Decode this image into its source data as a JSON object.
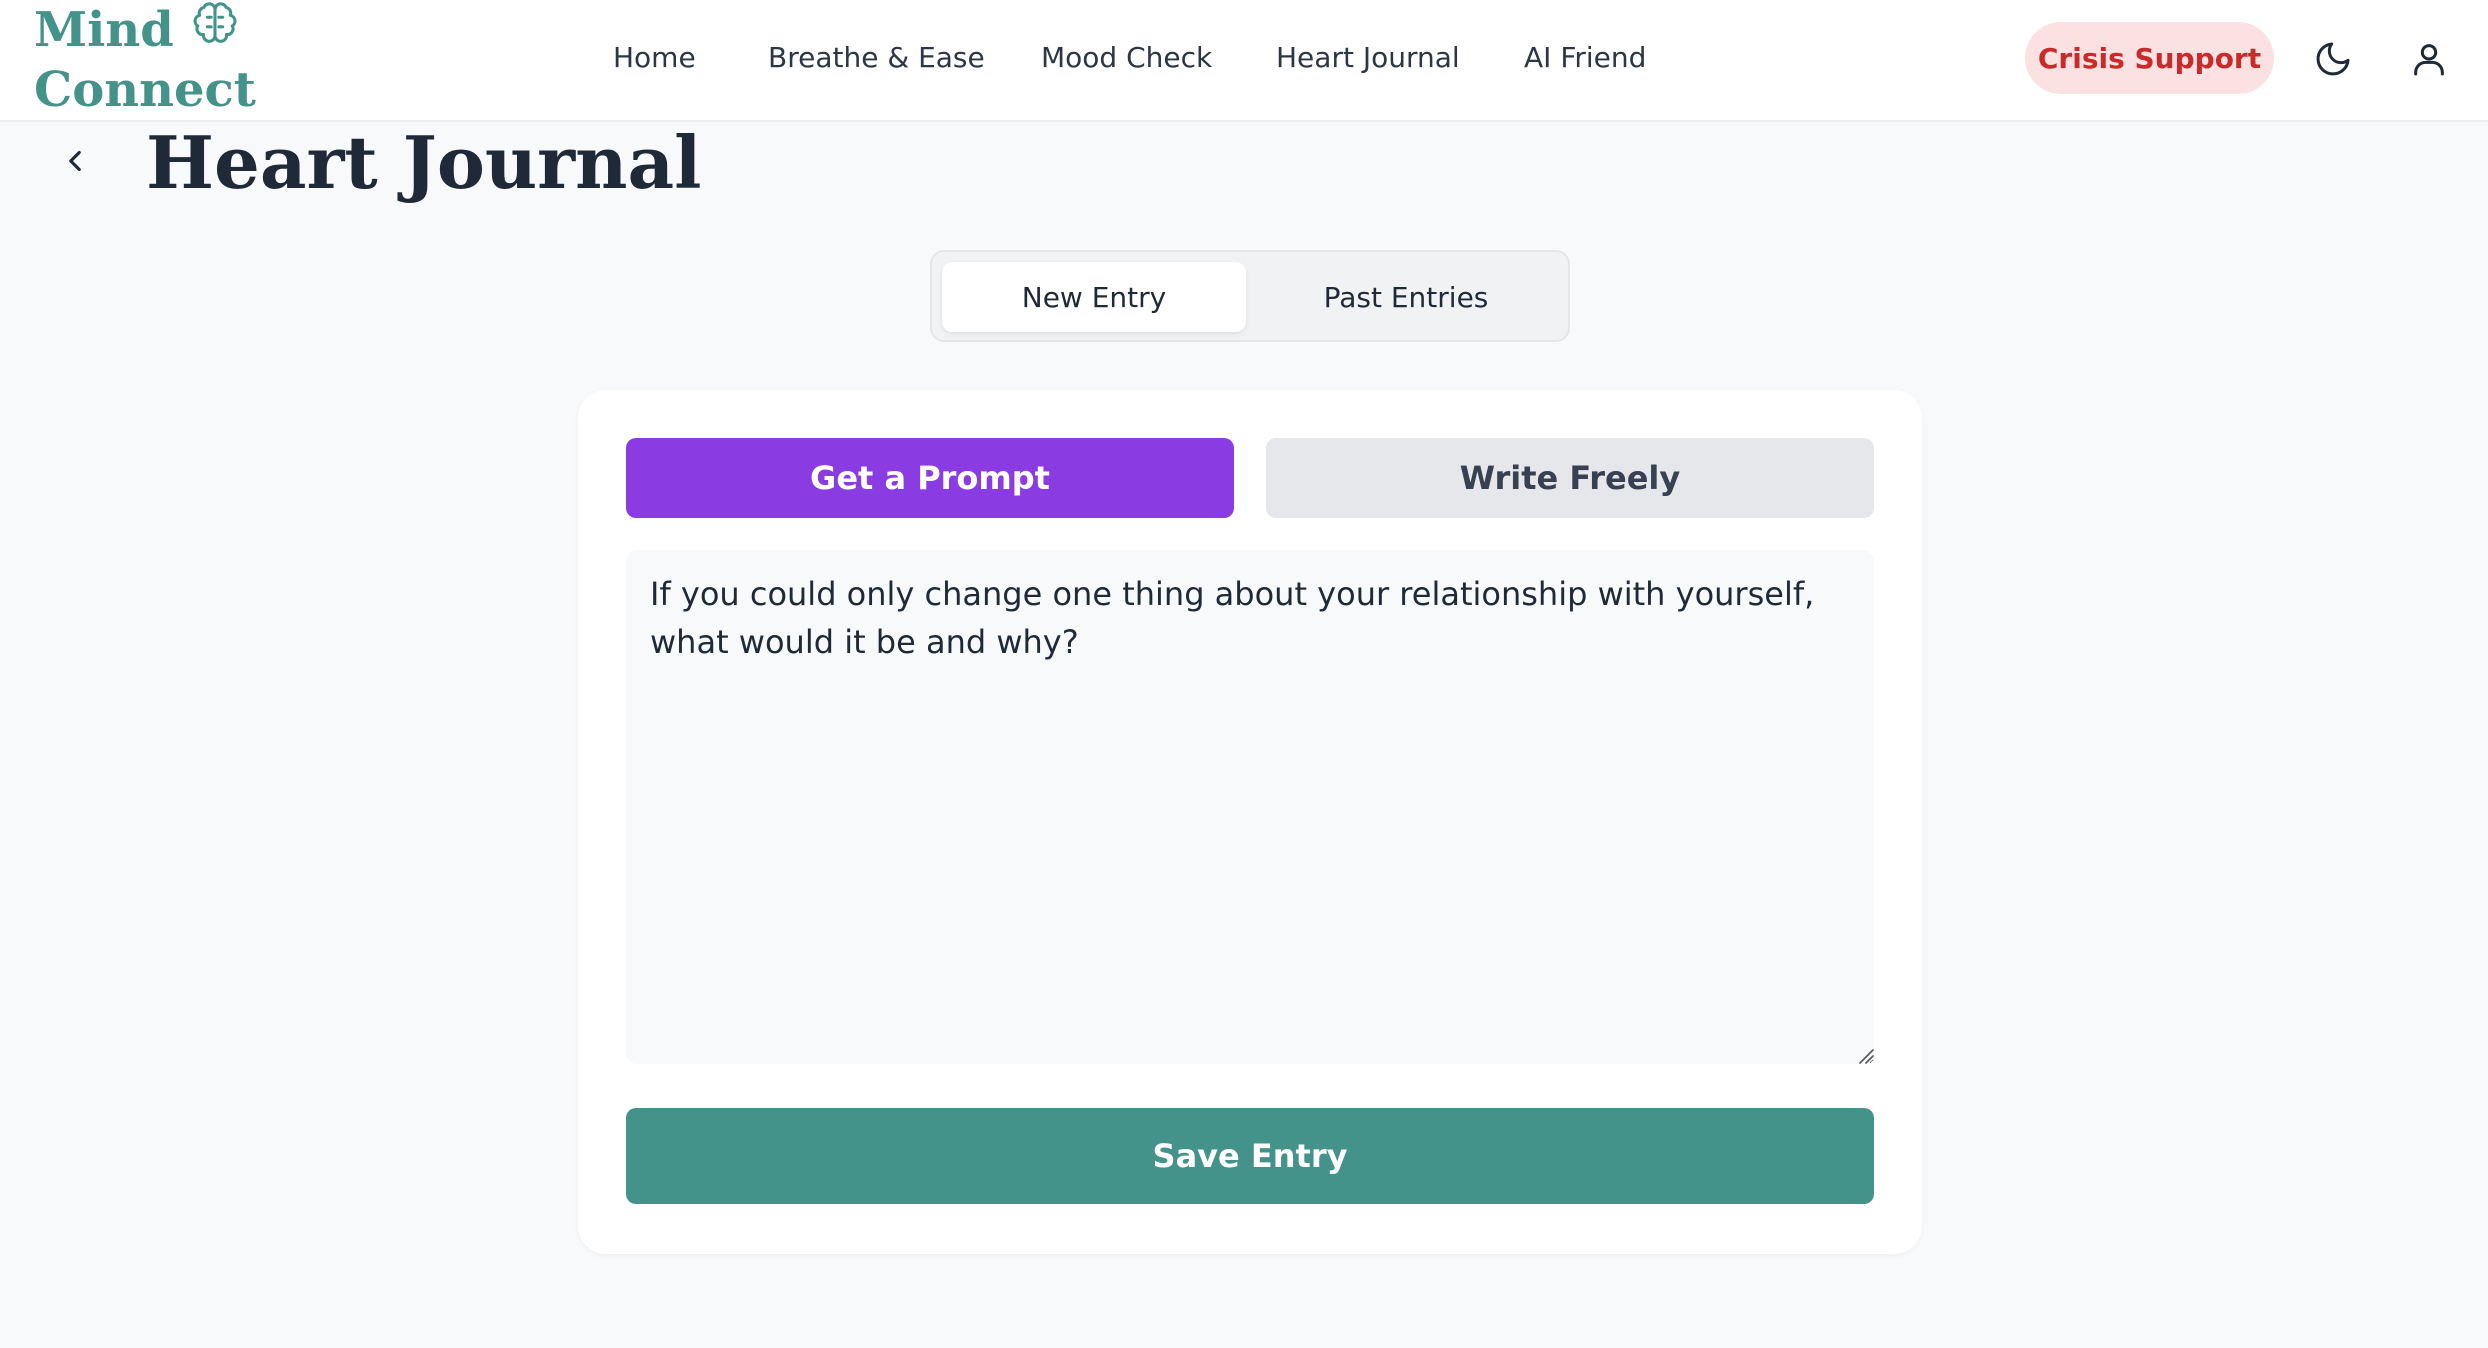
{
  "brand": {
    "line1": "Mind",
    "line2": "Connect",
    "icon": "brain-icon",
    "color": "#43938a"
  },
  "nav": {
    "items": [
      {
        "label": "Home"
      },
      {
        "label": "Breathe & Ease"
      },
      {
        "label": "Mood Check"
      },
      {
        "label": "Heart Journal"
      },
      {
        "label": "AI Friend"
      }
    ],
    "crisis_label": "Crisis Support",
    "theme_icon": "moon-icon",
    "profile_icon": "user-icon"
  },
  "page": {
    "title": "Heart Journal",
    "back_icon": "chevron-left-icon"
  },
  "tabs": [
    {
      "label": "New Entry",
      "active": true
    },
    {
      "label": "Past Entries",
      "active": false
    }
  ],
  "journal": {
    "prompt_button": "Get a Prompt",
    "free_button": "Write Freely",
    "entry_text": "If you could only change one thing about your relationship with yourself, what would it be and why?",
    "save_button": "Save Entry"
  },
  "colors": {
    "accent_purple": "#8a3be2",
    "accent_teal": "#43938a",
    "crisis_bg": "#fbe1e1",
    "crisis_text": "#c92a2a"
  }
}
